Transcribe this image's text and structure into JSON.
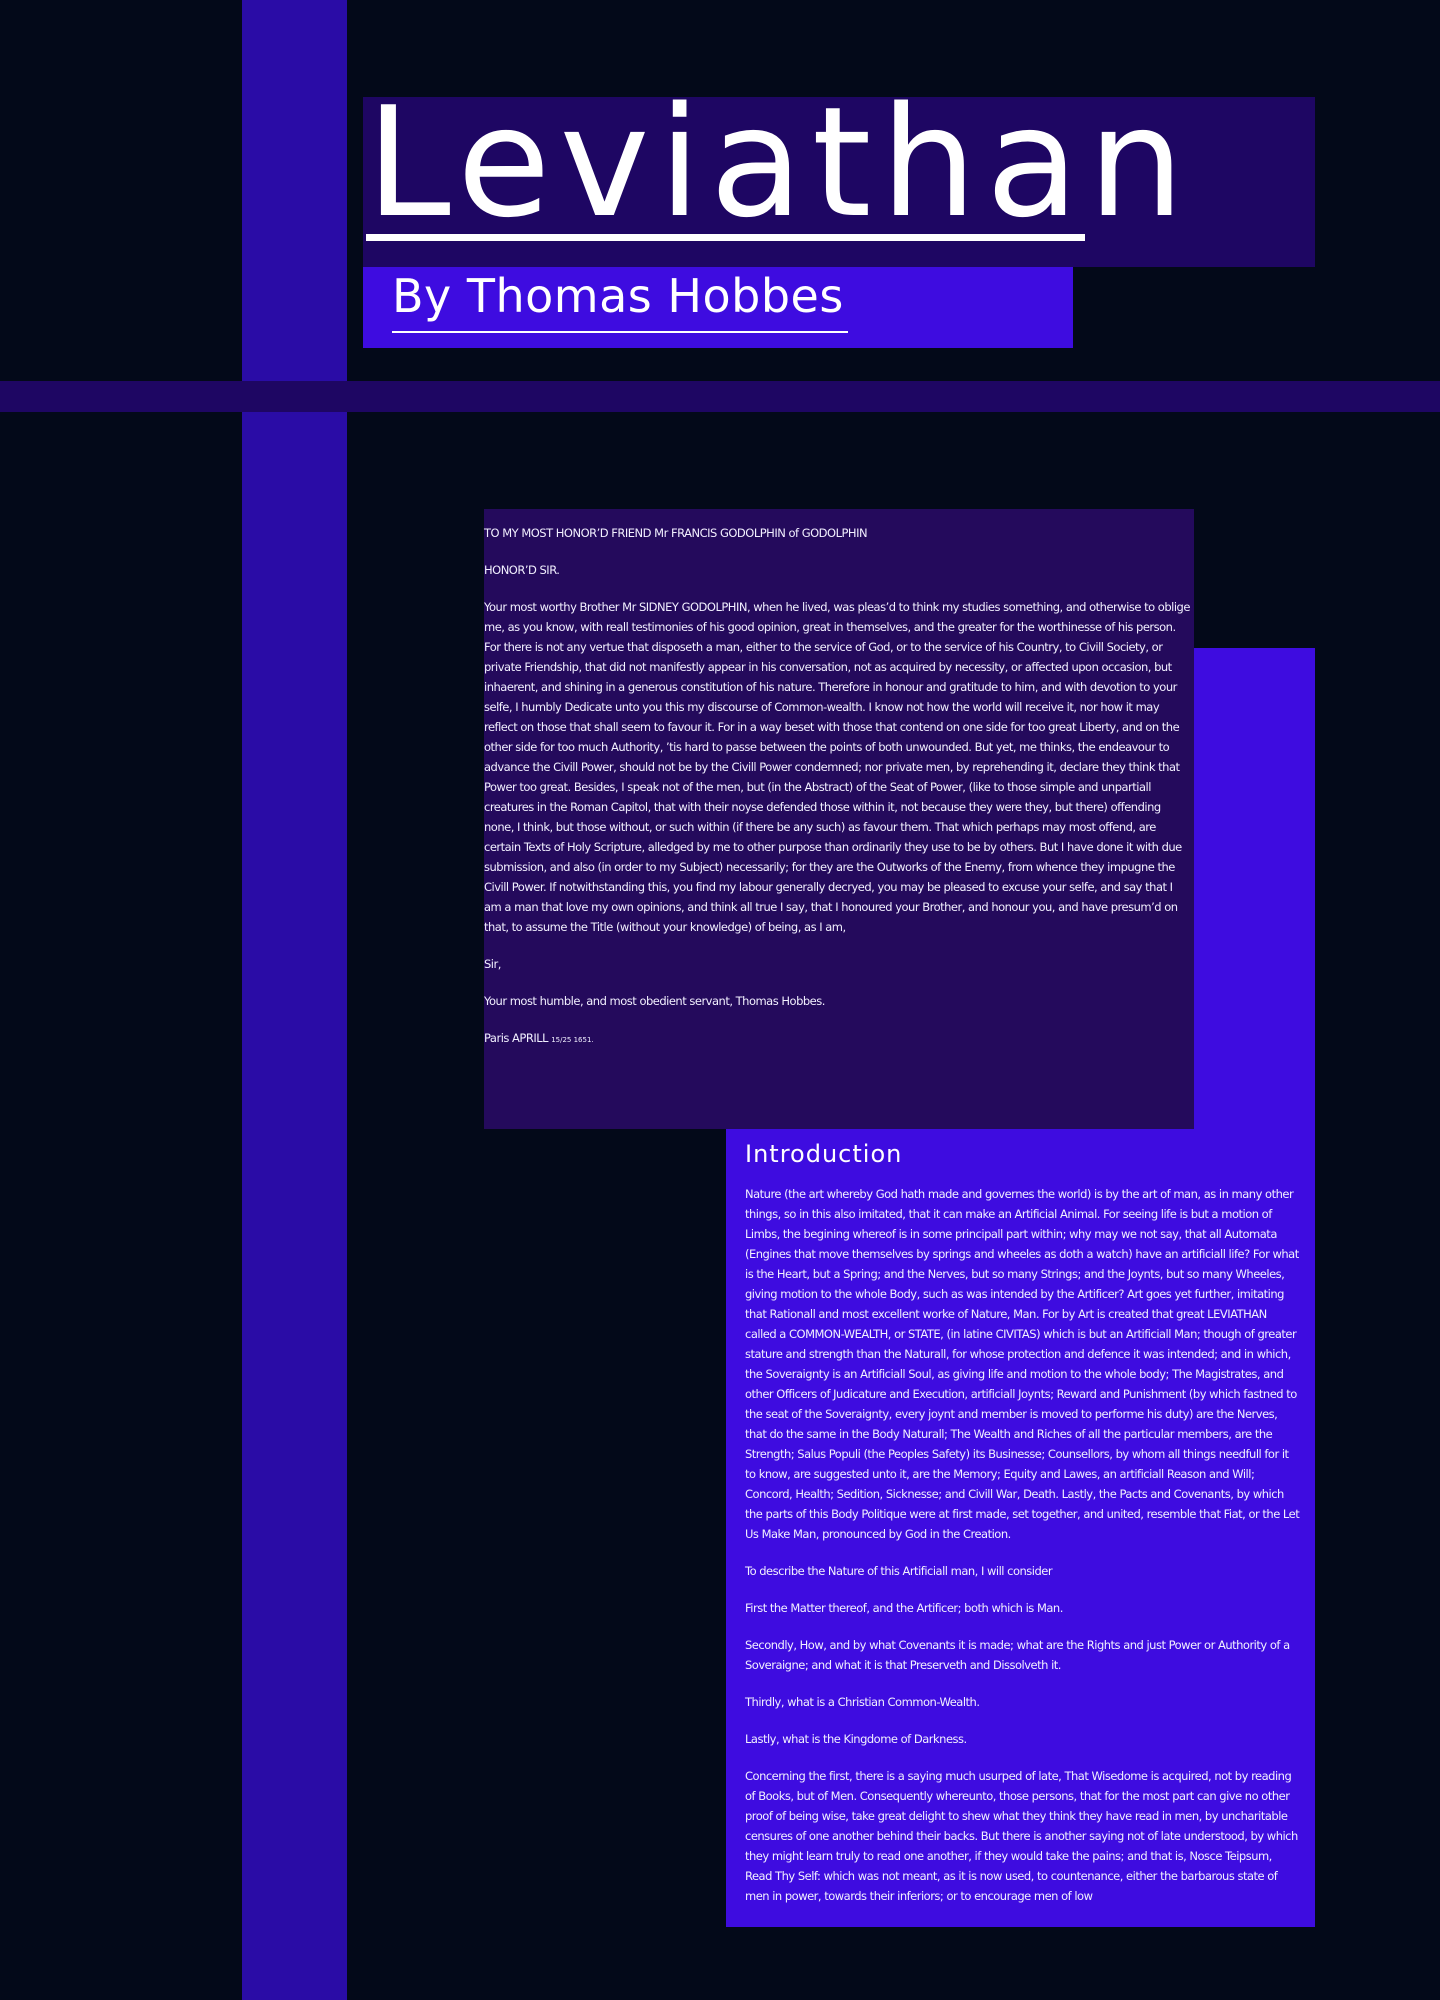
{
  "header": {
    "title": "Leviathan",
    "byline": "By Thomas Hobbes"
  },
  "dedication": {
    "paragraphs": [
      "TO MY MOST HONOR’D FRIEND Mr FRANCIS GODOLPHIN of GODOLPHIN",
      "HONOR’D SIR.",
      "Your most worthy Brother Mr SIDNEY GODOLPHIN, when he lived, was pleas’d to think my studies something, and otherwise to oblige me, as you know, with reall testimonies of his good opinion, great in themselves, and the greater for the worthinesse of his person. For there is not any vertue that disposeth a man, either to the service of God, or to the service of his Country, to Civill Society, or private Friendship, that did not manifestly appear in his conversation, not as acquired by necessity, or affected upon occasion, but inhaerent, and shining in a generous constitution of his nature. Therefore in honour and gratitude to him, and with devotion to your selfe, I humbly Dedicate unto you this my discourse of Common-wealth. I know not how the world will receive it, nor how it may reflect on those that shall seem to favour it. For in a way beset with those that contend on one side for too great Liberty, and on the other side for too much Authority, ’tis hard to passe between the points of both unwounded. But yet, me thinks, the endeavour to advance the Civill Power, should not be by the Civill Power condemned; nor private men, by reprehending it, declare they think that Power too great. Besides, I speak not of the men, but (in the Abstract) of the Seat of Power, (like to those simple and unpartiall creatures in the Roman Capitol, that with their noyse defended those within it, not because they were they, but there) offending none, I think, but those without, or such within (if there be any such) as favour them. That which perhaps may most offend, are certain Texts of Holy Scripture, alledged by me to other purpose than ordinarily they use to be by others. But I have done it with due submission, and also (in order to my Subject) necessarily; for they are the Outworks of the Enemy, from whence they impugne the Civill Power. If notwithstanding this, you find my labour generally decryed, you may be pleased to excuse your selfe, and say that I am a man that love my own opinions, and think all true I say, that I honoured your Brother, and honour you, and have presum’d on that, to assume the Title (without your knowledge) of being, as I am,",
      "Sir,",
      "Your most humble, and most obedient servant, Thomas Hobbes."
    ],
    "closing": "Paris APRILL",
    "closing_date": "15/25 1651."
  },
  "introduction": {
    "heading": "Introduction",
    "paragraphs": [
      "Nature (the art whereby God hath made and governes the world) is by the art of man, as in many other things, so in this also imitated, that it can make an Artificial Animal. For seeing life is but a motion of Limbs, the begining whereof is in some principall part within; why may we not say, that all Automata (Engines that move themselves by springs and wheeles as doth a watch) have an artificiall life? For what is the Heart, but a Spring; and the Nerves, but so many Strings; and the Joynts, but so many Wheeles, giving motion to the whole Body, such as was intended by the Artificer? Art goes yet further, imitating that Rationall and most excellent worke of Nature, Man. For by Art is created that great LEVIATHAN called a COMMON-WEALTH, or STATE, (in latine CIVITAS) which is but an Artificiall Man; though of greater stature and strength than the Naturall, for whose protection and defence it was intended; and in which, the Soveraignty is an Artificiall Soul, as giving life and motion to the whole body; The Magistrates, and other Officers of Judicature and Execution, artificiall Joynts; Reward and Punishment (by which fastned to the seat of the Soveraignty, every joynt and member is moved to performe his duty) are the Nerves, that do the same in the Body Naturall; The Wealth and Riches of all the particular members, are the Strength; Salus Populi (the Peoples Safety) its Businesse; Counsellors, by whom all things needfull for it to know, are suggested unto it, are the Memory; Equity and Lawes, an artificiall Reason and Will; Concord, Health; Sedition, Sicknesse; and Civill War, Death. Lastly, the Pacts and Covenants, by which the parts of this Body Politique were at first made, set together, and united, resemble that Fiat, or the Let Us Make Man, pronounced by God in the Creation.",
      "To describe the Nature of this Artificiall man, I will consider",
      "First the Matter thereof, and the Artificer; both which is Man.",
      "Secondly, How, and by what Covenants it is made; what are the Rights and just Power or Authority of a Soveraigne; and what it is that Preserveth and Dissolveth it.",
      "Thirdly, what is a Christian Common-Wealth.",
      "Lastly, what is the Kingdome of Darkness.",
      "Concerning the first, there is a saying much usurped of late, That Wisedome is acquired, not by reading of Books, but of Men. Consequently whereunto, those persons, that for the most part can give no other proof of being wise, take great delight to shew what they think they have read in men, by uncharitable censures of one another behind their backs. But there is another saying not of late understood, by which they might learn truly to read one another, if they would take the pains; and that is, Nosce Teipsum, Read Thy Self: which was not meant, as it is now used, to countenance, either the barbarous state of men in power, towards their inferiors; or to encourage men of low"
    ]
  },
  "colors": {
    "background": "#030919",
    "bar_blue": "#2a0ca6",
    "dark_purple": "#1e0663",
    "bright_blue": "#3e0ce0",
    "dedication_bg": "#240a5c"
  }
}
